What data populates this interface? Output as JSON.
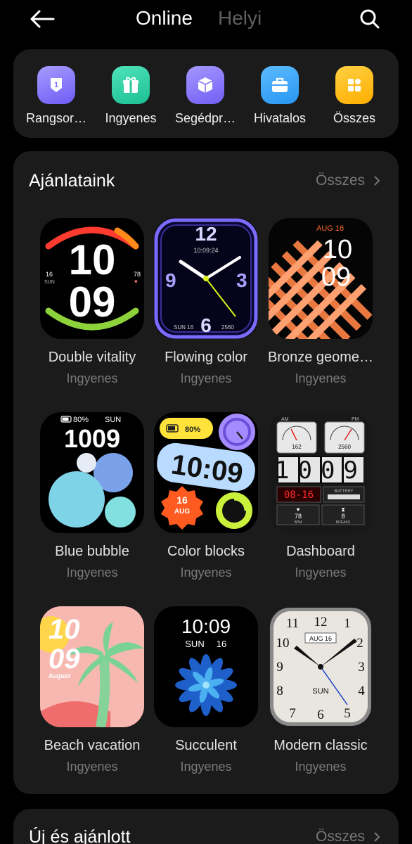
{
  "header": {
    "tabs": [
      {
        "label": "Online",
        "active": true
      },
      {
        "label": "Helyi",
        "active": false
      }
    ]
  },
  "categories": [
    {
      "label": "Rangsor…",
      "icon": "ranking-icon",
      "color": "#8a7dff"
    },
    {
      "label": "Ingyenes",
      "icon": "gift-icon",
      "color": "#2fd1a7"
    },
    {
      "label": "Segédpr…",
      "icon": "cube-icon",
      "color": "#8d7bff"
    },
    {
      "label": "Hivatalos",
      "icon": "briefcase-icon",
      "color": "#3aa6ff"
    },
    {
      "label": "Összes",
      "icon": "grid-icon",
      "color": "#ffbf1a"
    }
  ],
  "recommended": {
    "title": "Ajánlataink",
    "more": "Összes",
    "items": [
      {
        "name": "Double vitality",
        "price": "Ingyenes"
      },
      {
        "name": "Flowing color",
        "price": "Ingyenes"
      },
      {
        "name": "Bronze geome…",
        "price": "Ingyenes"
      },
      {
        "name": "Blue bubble",
        "price": "Ingyenes"
      },
      {
        "name": "Color blocks",
        "price": "Ingyenes"
      },
      {
        "name": "Dashboard",
        "price": "Ingyenes"
      },
      {
        "name": "Beach vacation",
        "price": "Ingyenes"
      },
      {
        "name": "Succulent",
        "price": "Ingyenes"
      },
      {
        "name": "Modern classic",
        "price": "Ingyenes"
      }
    ]
  },
  "faces": {
    "double_vitality": {
      "hour": "10",
      "min": "09",
      "day": "16",
      "dow": "SUN",
      "hr": "78"
    },
    "flowing_color": {
      "top": "12",
      "time": "10:09:24",
      "left": "9",
      "right": "3",
      "bottom": "6",
      "date": "SUN 16",
      "steps": "2560"
    },
    "bronze": {
      "date": "AUG 16",
      "hour": "10",
      "min": "09"
    },
    "blue_bubble": {
      "battery": "80%",
      "dow": "SUN",
      "time": "1009"
    },
    "color_blocks": {
      "battery": "80%",
      "time": "10:09",
      "day": "16",
      "month": "AUG"
    },
    "dashboard": {
      "am": "AM",
      "pm": "PM",
      "val1": "162",
      "val2": "2560",
      "digits": "1009",
      "date": "08-16",
      "battery": "BATTERY",
      "bpm": "78",
      "bpm_label": "BPM",
      "breaks": "8",
      "breaks_label": "BREAKS"
    },
    "beach": {
      "hour": "10",
      "min": "09",
      "month": "August"
    },
    "succulent": {
      "time": "10:09",
      "dow": "SUN",
      "day": "16"
    },
    "modern_classic": {
      "date": "AUG 16",
      "dow": "SUN",
      "n12": "12",
      "n11": "11",
      "n1": "1",
      "n10": "10",
      "n2": "2",
      "n9": "9",
      "n3": "3",
      "n8": "8",
      "n4": "4",
      "n7": "7",
      "n6": "6",
      "n5": "5"
    }
  },
  "new_section": {
    "title": "Új és ajánlott",
    "more": "Összes"
  }
}
